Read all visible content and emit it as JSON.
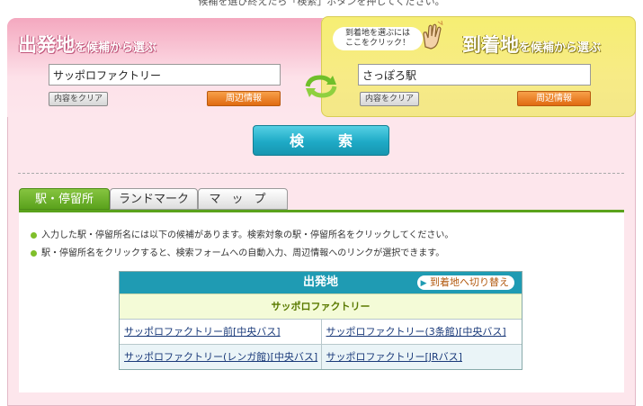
{
  "top_note": "候補を選び終えたら「検索」ボタンを押してください。",
  "departure": {
    "heading_big": "出発地",
    "heading_small": "を候補から選ぶ",
    "value": "サッポロファクトリー",
    "clear_label": "内容をクリア",
    "info_label": "周辺情報"
  },
  "arrival": {
    "bubble_text": "到着地を選ぶには\nここをクリック！",
    "heading_big": "到着地",
    "heading_small": "を候補から選ぶ",
    "value": "さっぽろ駅",
    "clear_label": "内容をクリア",
    "info_label": "周辺情報"
  },
  "search_label": "検索",
  "tabs": [
    {
      "label": "駅・停留所",
      "active": true
    },
    {
      "label": "ランドマーク",
      "active": false
    },
    {
      "label": "マップ",
      "active": false
    }
  ],
  "notes": [
    "入力した駅・停留所名には以下の候補があります。検索対象の駅・停留所名をクリックしてください。",
    "駅・停留所名をクリックすると、検索フォームへの自動入力、周辺情報へのリンクが選択できます。"
  ],
  "candidates": {
    "header": "出発地",
    "switch_label": "到着地へ切り替え",
    "group": "サッポロファクトリー",
    "rows": [
      [
        "サッポロファクトリー前[中央バス]",
        "サッポロファクトリー(3条館)[中央バス]"
      ],
      [
        "サッポロファクトリー(レンガ館)[中央バス]",
        "サッポロファクトリー[JRバス]"
      ]
    ]
  },
  "colors": {
    "departure_accent": "#f4a8bf",
    "arrival_accent": "#f6ee73",
    "search_button": "#1eaac6",
    "tab_active": "#5aa21c",
    "info_button": "#e06a10"
  }
}
